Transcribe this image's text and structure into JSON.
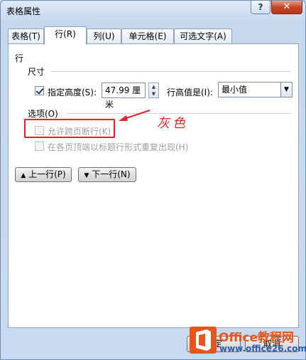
{
  "window": {
    "title": "表格属性",
    "help_label": "?",
    "close_label": "✕"
  },
  "tabs": [
    {
      "label": "表格(T)"
    },
    {
      "label": "行(R)"
    },
    {
      "label": "列(U)"
    },
    {
      "label": "单元格(E)"
    },
    {
      "label": "可选文字(A)"
    }
  ],
  "panel": {
    "section_label": "行",
    "size_group": {
      "label": "尺寸",
      "specify_height": {
        "label": "指定高度(S):",
        "checked": true
      },
      "height_value": "47.99 厘米",
      "row_height_is": {
        "label": "行高值是(I):",
        "value": "最小值"
      }
    },
    "options_group": {
      "label": "选项(O)",
      "allow_break": {
        "label": "允许跨页断行(K)",
        "checked": false,
        "enabled": false
      },
      "repeat_header": {
        "label": "在各页顶端以标题行形式重复出现(H)",
        "checked": false,
        "enabled": false
      }
    },
    "prev_row_label": "上一行(P)",
    "next_row_label": "下一行(N)",
    "prev_icon": "triangle-up-icon",
    "next_icon": "triangle-down-icon"
  },
  "annotation": {
    "text": "灰色",
    "color": "#e0242b"
  },
  "footer": {
    "ok_label": "确定",
    "cancel_label": "取消"
  },
  "watermark": {
    "line1": "Office教程网",
    "line2": "www.office26.com",
    "logo_icon": "office-logo-icon"
  }
}
